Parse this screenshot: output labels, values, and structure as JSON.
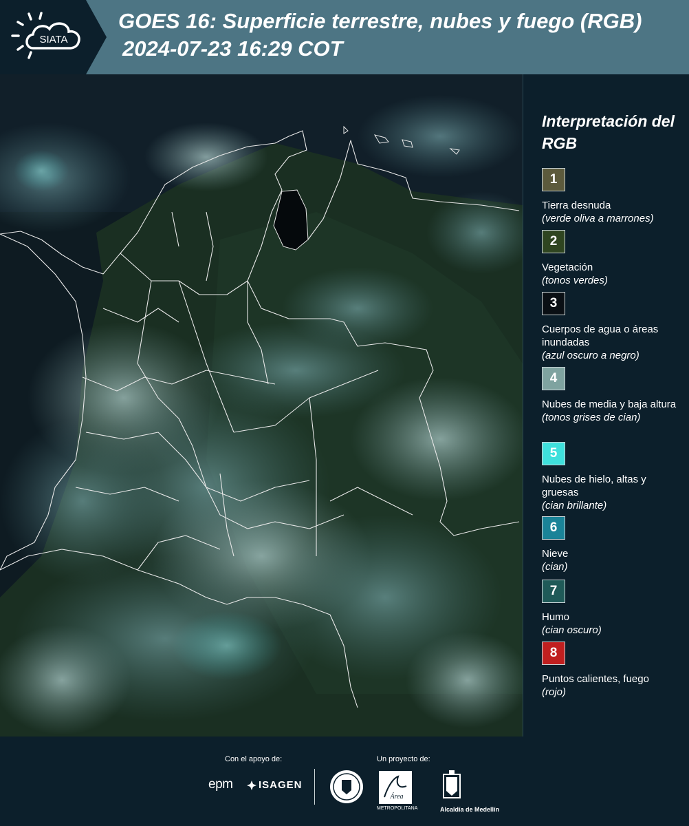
{
  "header": {
    "logo_text": "SIATA",
    "title": "GOES 16: Superficie terrestre, nubes y fuego (RGB)",
    "datetime": "2024-07-23 16:29 COT"
  },
  "legend": {
    "title": "Interpretación del RGB",
    "items": [
      {
        "number": "1",
        "color": "#5c5a3c",
        "label": "Tierra desnuda",
        "note": "(verde oliva a marrones)"
      },
      {
        "number": "2",
        "color": "#2f4520",
        "label": "Vegetación",
        "note": "(tonos verdes)"
      },
      {
        "number": "3",
        "color": "#0a0f14",
        "label": "Cuerpos de agua o áreas inundadas",
        "note": "(azul oscuro a negro)"
      },
      {
        "number": "4",
        "color": "#7fa3a0",
        "label": "Nubes de media y baja altura",
        "note": "(tonos grises de cian)"
      },
      {
        "number": "5",
        "color": "#3fe0dc",
        "label": "Nubes de hielo, altas y gruesas",
        "note": "(cian brillante)"
      },
      {
        "number": "6",
        "color": "#1a8398",
        "label": "Nieve",
        "note": "(cian)"
      },
      {
        "number": "7",
        "color": "#1f5a58",
        "label": "Humo",
        "note": "(cian oscuro)"
      },
      {
        "number": "8",
        "color": "#c01f1f",
        "label": "Puntos calientes, fuego",
        "note": "(rojo)"
      }
    ]
  },
  "footer": {
    "support_label": "Con el apoyo de:",
    "project_label": "Un proyecto de:",
    "sponsors": [
      "epm",
      "ISAGEN"
    ],
    "area_text": "METROPOLITANA",
    "alcaldia": "Alcaldía de Medellín"
  }
}
